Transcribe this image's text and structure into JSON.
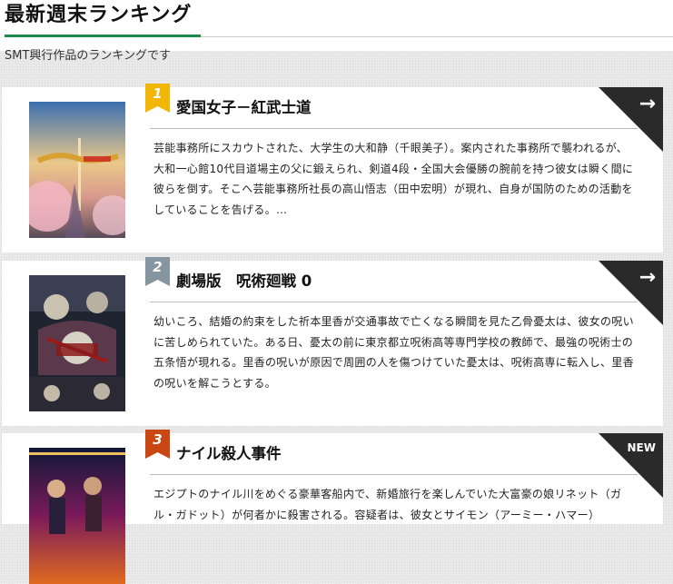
{
  "page": {
    "title": "最新週末ランキング",
    "subtitle": "SMT興行作品のランキングです"
  },
  "colors": {
    "accent_green": "#1a8a4a",
    "rank1": "#f2b705",
    "rank2": "#8696a0",
    "rank3": "#c94712",
    "corner": "#2a2a2a"
  },
  "rankings": [
    {
      "rank": "1",
      "title": "愛国女子－紅武士道",
      "synopsis": "芸能事務所にスカウトされた、大学生の大和静（千眼美子）。案内された事務所で襲われるが、大和一心館10代目道場主の父に鍛えられ、剣道4段・全国大会優勝の腕前を持つ彼女は瞬く間に彼らを倒す。そこへ芸能事務所社長の高山悟志（田中宏明）が現れ、自身が国防のための活動をしていることを告げる。…",
      "corner": "arrow-right-icon"
    },
    {
      "rank": "2",
      "title": "劇場版　呪術廻戦 0",
      "synopsis": "幼いころ、結婚の約束をした祈本里香が交通事故で亡くなる瞬間を見た乙骨憂太は、彼女の呪いに苦しめられていた。ある日、憂太の前に東京都立呪術高等専門学校の教師で、最強の呪術士の五条悟が現れる。里香の呪いが原因で周囲の人を傷つけていた憂太は、呪術高専に転入し、里香の呪いを解こうとする。",
      "corner": "arrow-right-icon"
    },
    {
      "rank": "3",
      "title": "ナイル殺人事件",
      "synopsis": "エジプトのナイル川をめぐる豪華客船内で、新婚旅行を楽しんでいた大富豪の娘リネット（ガル・ガドット）が何者かに殺害される。容疑者は、彼女とサイモン（アーミー・ハマー）",
      "corner_label": "NEW"
    }
  ]
}
